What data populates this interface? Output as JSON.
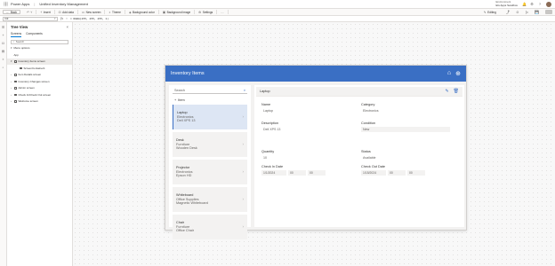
{
  "topbar": {
    "app_name": "Power Apps",
    "separator": "|",
    "project_name": "Unified Inventory Management",
    "environment_label": "Environment",
    "environment_name": "EG Apps Sandbox"
  },
  "commands": {
    "back": "Back",
    "insert": "Insert",
    "add_data": "Add data",
    "new_screen": "New screen",
    "theme": "Theme",
    "background_color": "Background color",
    "background_image": "Background image",
    "settings": "Settings",
    "editing": "Editing"
  },
  "formula": {
    "property": "Fill",
    "fx": "fx",
    "expression": "= RGBA(255, 255, 255, 1)"
  },
  "tree": {
    "title": "Tree View",
    "tabs": [
      "Screens",
      "Components"
    ],
    "search_placeholder": "Search",
    "items": [
      {
        "label": "Menu options",
        "indent": 0,
        "chev": "▾"
      },
      {
        "label": "App",
        "indent": 0,
        "chev": ""
      },
      {
        "label": "Inventory Items screen",
        "indent": 0,
        "chev": "▾"
      },
      {
        "label": "ScreenContainer1",
        "indent": 1,
        "chev": ""
      },
      {
        "label": "Item Details screen",
        "indent": 0,
        "chev": "›"
      },
      {
        "label": "Inventory Changes screen",
        "indent": 0,
        "chev": "›"
      },
      {
        "label": "Admin screen",
        "indent": 0,
        "chev": "›"
      },
      {
        "label": "Check In/Check Out screen",
        "indent": 0,
        "chev": "›"
      },
      {
        "label": "Welcome screen",
        "indent": 0,
        "chev": "›"
      }
    ]
  },
  "app": {
    "title": "Inventory Items",
    "search_placeholder": "Search",
    "new_label": "Item",
    "items": [
      {
        "title": "Laptop",
        "line2": "Electronics",
        "line3": "Dell XPS 13"
      },
      {
        "title": "Desk",
        "line2": "Furniture",
        "line3": "Wooden Desk"
      },
      {
        "title": "Projector",
        "line2": "Electronics",
        "line3": "Epson HD"
      },
      {
        "title": "Whiteboard",
        "line2": "Office Supplies",
        "line3": "Magnetic Whiteboard"
      },
      {
        "title": "Chair",
        "line2": "Furniture",
        "line3": "Office Chair"
      }
    ],
    "detail": {
      "header": "Laptop",
      "name_label": "Name",
      "name_value": "Laptop",
      "category_label": "Category",
      "category_value": "Electronics",
      "description_label": "Description",
      "description_value": "Dell XPS 13",
      "condition_label": "Condition",
      "condition_value": "New",
      "quantity_label": "Quantity",
      "quantity_value": "10",
      "status_label": "Status",
      "status_value": "Available",
      "checkin_label": "Check In Date",
      "checkin_date": "1/1/2024",
      "checkin_hour": "00",
      "checkin_min": "00",
      "checkout_label": "Check Out Date",
      "checkout_date": "1/15/2024",
      "checkout_hour": "00",
      "checkout_min": "00"
    }
  }
}
